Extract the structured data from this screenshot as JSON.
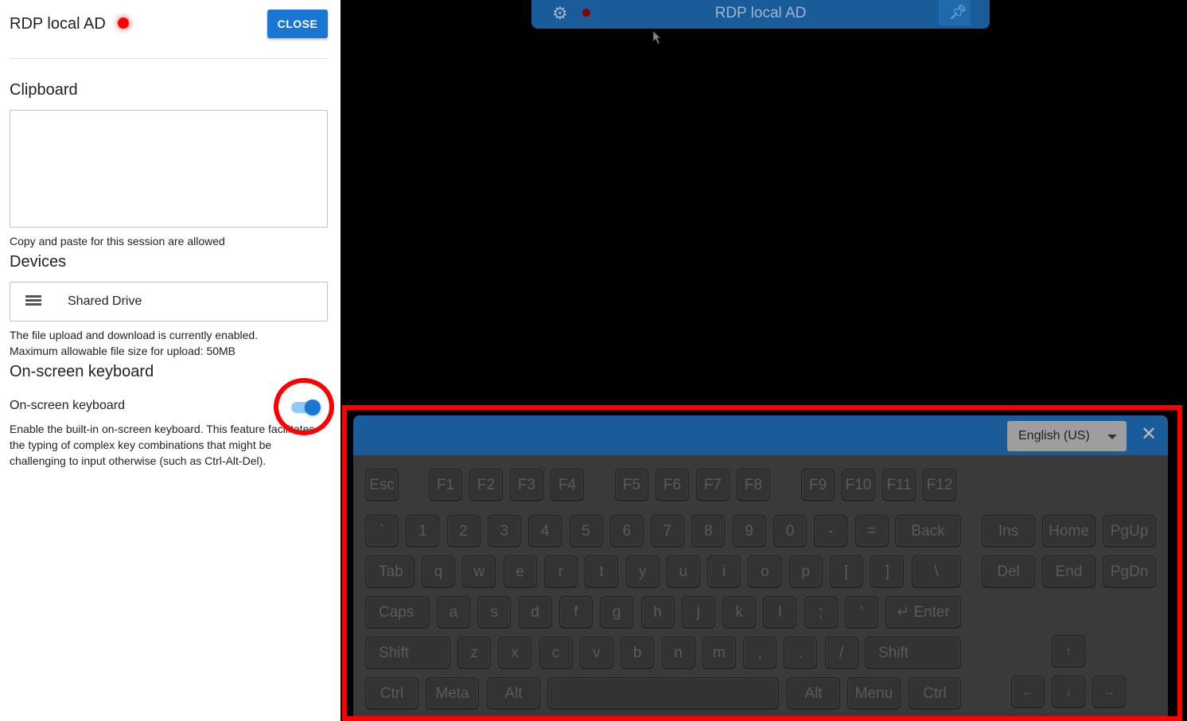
{
  "sidebar": {
    "title": "RDP local AD",
    "close_label": "CLOSE",
    "clipboard": {
      "title": "Clipboard",
      "value": "",
      "note": "Copy and paste for this session are allowed"
    },
    "devices": {
      "title": "Devices",
      "item": "Shared Drive",
      "note1": "The file upload and download is currently enabled.",
      "note2": "Maximum allowable file size for upload: 50MB"
    },
    "osk": {
      "title": "On-screen keyboard",
      "toggle_label": "On-screen keyboard",
      "enabled": true,
      "description": "Enable the built-in on-screen keyboard. This feature facilitates the typing of complex key combinations that might be challenging to input otherwise (such as Ctrl-Alt-Del)."
    }
  },
  "session_bar": {
    "title": "RDP local AD"
  },
  "keyboard": {
    "language": "English (US)",
    "rows": {
      "fn": [
        "Esc",
        "F1",
        "F2",
        "F3",
        "F4",
        "F5",
        "F6",
        "F7",
        "F8",
        "F9",
        "F10",
        "F11",
        "F12"
      ],
      "num": [
        "`",
        "1",
        "2",
        "3",
        "4",
        "5",
        "6",
        "7",
        "8",
        "9",
        "0",
        "-",
        "=",
        "Back"
      ],
      "tab": [
        "Tab",
        "q",
        "w",
        "e",
        "r",
        "t",
        "y",
        "u",
        "i",
        "o",
        "p",
        "[",
        "]",
        "\\"
      ],
      "caps": [
        "Caps",
        "a",
        "s",
        "d",
        "f",
        "g",
        "h",
        "j",
        "k",
        "l",
        ";",
        "'",
        "↵ Enter"
      ],
      "shift": [
        "Shift",
        "z",
        "x",
        "c",
        "v",
        "b",
        "n",
        "m",
        ",",
        ".",
        "/",
        "Shift"
      ],
      "bottom": [
        "Ctrl",
        "Meta",
        "Alt",
        "",
        "Alt",
        "Menu",
        "Ctrl"
      ],
      "nav1": [
        "Ins",
        "Home",
        "PgUp"
      ],
      "nav2": [
        "Del",
        "End",
        "PgDn"
      ],
      "arrows": [
        "↑",
        "←",
        "↓",
        "→"
      ]
    }
  },
  "colors": {
    "accent": "#1976d2",
    "session_bar": "#1a5c99",
    "status": "#ff0000"
  }
}
